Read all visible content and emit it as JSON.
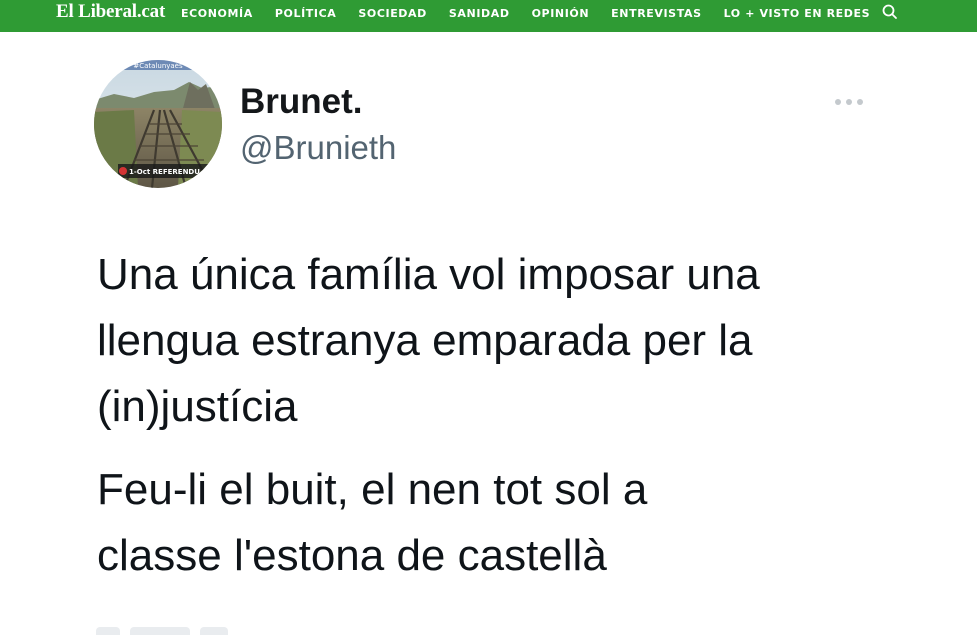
{
  "header": {
    "brand": "El Liberal.cat",
    "nav_items": [
      "ECONOMÍA",
      "POLÍTICA",
      "SOCIEDAD",
      "SANIDAD",
      "OPINIÓN",
      "ENTREVISTAS",
      "LO + VISTO EN REDES"
    ],
    "search_icon": "search-icon",
    "background_color": "#2f9b34"
  },
  "tweet": {
    "display_name": "Brunet.",
    "handle": "@Brunieth",
    "more_icon": "more-horizontal-icon",
    "avatar_banner_top": "#Catalunyaés",
    "avatar_banner_bottom": "1-Oct REFERENDU",
    "paragraph_1": [
      "Una única família vol imposar una",
      "llengua estranya emparada per la",
      "(in)justícia"
    ],
    "paragraph_2": [
      "Feu-li el buit, el nen tot sol a",
      "classe l'estona de castellà"
    ]
  }
}
